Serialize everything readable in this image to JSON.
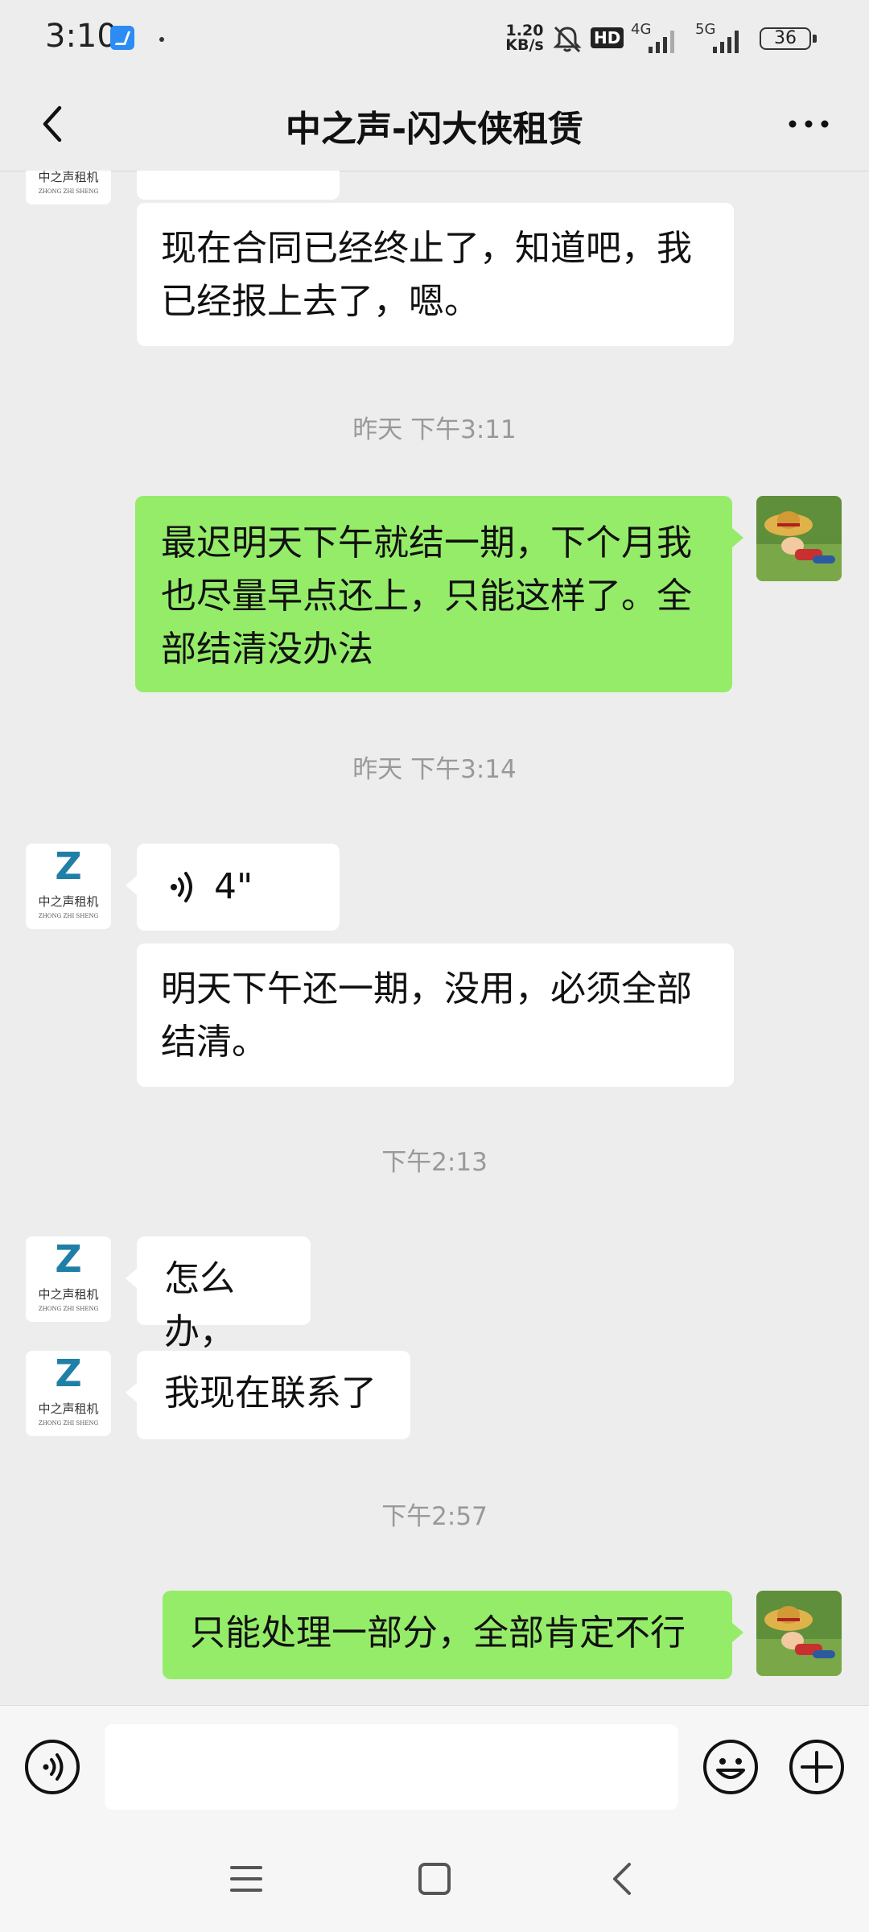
{
  "status_bar": {
    "time": "3:10",
    "net_speed_value": "1.20",
    "net_speed_unit": "KB/s",
    "hd_label": "HD",
    "signal_1_label": "4G",
    "signal_2_label": "5G",
    "battery": "36",
    "icons": [
      "app-notification-icon",
      "mute-bell-icon",
      "signal-icon",
      "battery-icon"
    ]
  },
  "header": {
    "title": "中之声-闪大侠租赁",
    "back_icon": "chevron-left-icon",
    "more_icon": "more-dots-icon"
  },
  "contact": {
    "avatar_logo_letter": "Z",
    "avatar_caption": "中之声租机",
    "avatar_subcaption": "ZHONG ZHI SHENG"
  },
  "messages": [
    {
      "type": "text",
      "from": "them",
      "text": "现在合同已经终止了，知道吧，我已经报上去了，嗯。"
    },
    {
      "type": "time",
      "text": "昨天 下午3:11"
    },
    {
      "type": "text",
      "from": "me",
      "text": "最迟明天下午就结一期，下个月我也尽量早点还上，只能这样了。全部结清没办法"
    },
    {
      "type": "time",
      "text": "昨天 下午3:14"
    },
    {
      "type": "voice",
      "from": "them",
      "duration": "4\""
    },
    {
      "type": "text",
      "from": "them",
      "text": "明天下午还一期，没用，必须全部结清。"
    },
    {
      "type": "time",
      "text": "下午2:13"
    },
    {
      "type": "text",
      "from": "them",
      "text": "怎么办，"
    },
    {
      "type": "text",
      "from": "them",
      "text": "我现在联系了"
    },
    {
      "type": "time",
      "text": "下午2:57"
    },
    {
      "type": "text",
      "from": "me",
      "text": "只能处理一部分，全部肯定不行"
    }
  ],
  "input_bar": {
    "voice_icon": "voice-input-icon",
    "emoji_icon": "emoji-icon",
    "plus_icon": "plus-icon",
    "value": ""
  },
  "system_nav": {
    "icons": [
      "menu-icon",
      "home-icon",
      "back-icon"
    ]
  },
  "colors": {
    "background": "#ededed",
    "outgoing_bubble": "#95ec69",
    "incoming_bubble": "#ffffff",
    "timestamp": "#999999"
  }
}
